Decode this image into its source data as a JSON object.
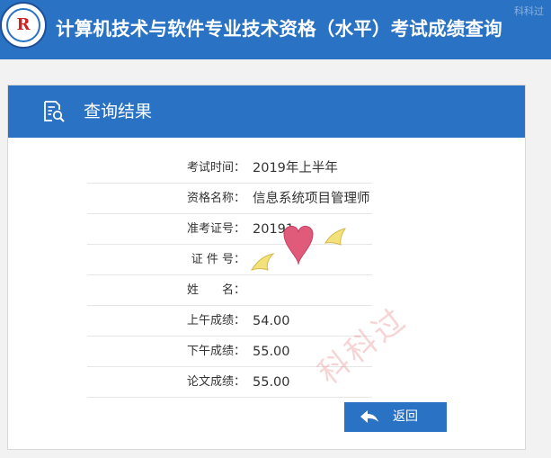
{
  "header": {
    "title": "计算机技术与软件专业技术资格（水平）考试成绩查询",
    "corner_watermark": "科科过"
  },
  "panel": {
    "title": "查询结果",
    "rows": [
      {
        "label": "考试时间：",
        "value": "2019年上半年"
      },
      {
        "label": "资格名称：",
        "value": "信息系统项目管理师"
      },
      {
        "label": "准考证号：",
        "value": "20191"
      },
      {
        "label": "证 件 号：",
        "value": ""
      },
      {
        "label": "姓　　名：",
        "value": ""
      },
      {
        "label": "上午成绩：",
        "value": "54.00"
      },
      {
        "label": "下午成绩：",
        "value": "55.00"
      },
      {
        "label": "论文成绩：",
        "value": "55.00"
      }
    ],
    "back_label": "返回"
  },
  "watermark": "科科过",
  "colors": {
    "header": "#2a72c3",
    "button": "#2a72c3",
    "heart": "#e05a7a",
    "wings": "#f3e27a"
  },
  "icons": [
    "logo",
    "search-doc-icon",
    "back-arrow-icon",
    "heart-sticker"
  ]
}
